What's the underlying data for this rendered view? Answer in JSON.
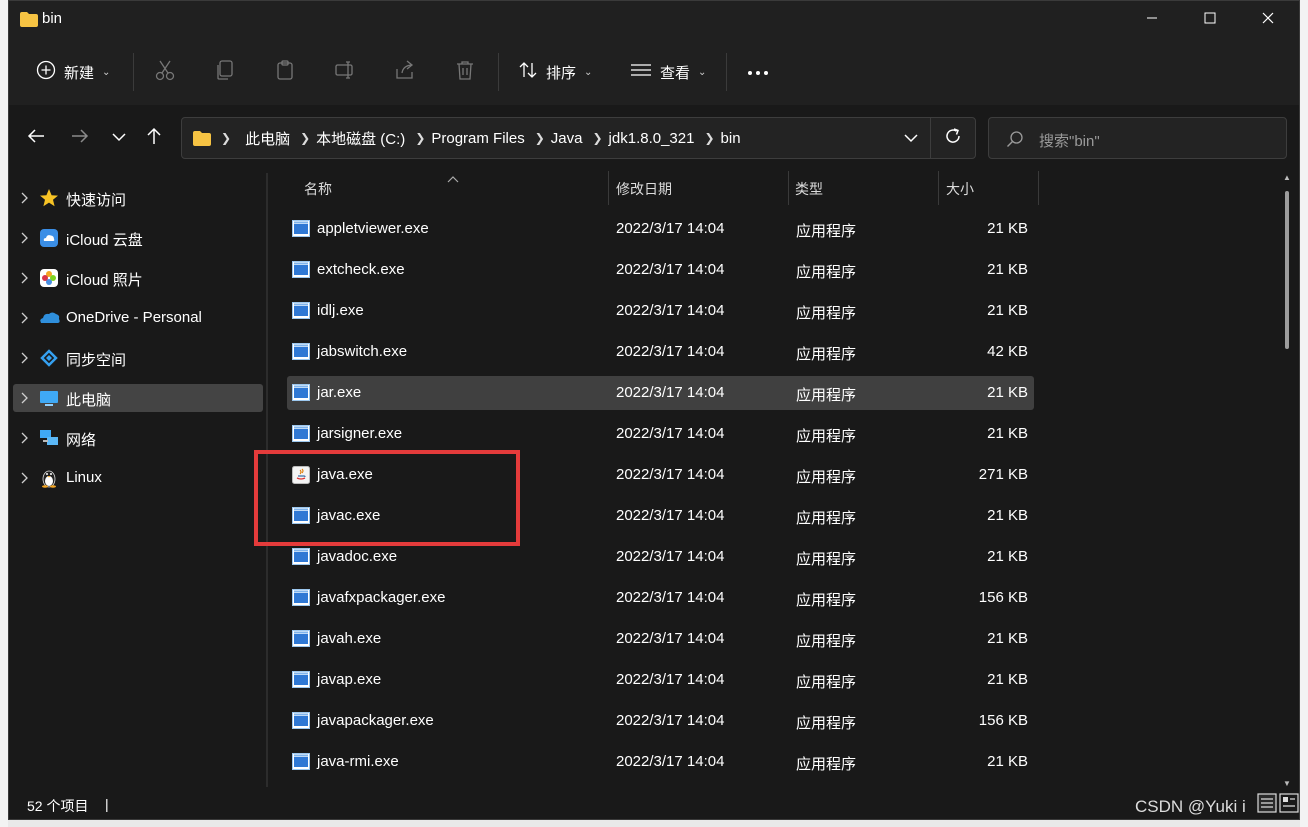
{
  "window": {
    "title": "bin",
    "controls": {
      "minimize": "minimize-icon",
      "maximize": "maximize-icon",
      "close": "close-icon"
    }
  },
  "toolbar": {
    "new_label": "新建",
    "sort_label": "排序",
    "view_label": "查看",
    "icons": [
      "cut-icon",
      "copy-icon",
      "paste-icon",
      "rename-icon",
      "share-icon",
      "delete-icon",
      "more-icon"
    ]
  },
  "address": {
    "breadcrumbs": [
      "此电脑",
      "本地磁盘 (C:)",
      "Program Files",
      "Java",
      "jdk1.8.0_321",
      "bin"
    ]
  },
  "search": {
    "placeholder": "搜索\"bin\""
  },
  "sidebar": {
    "items": [
      {
        "label": "快速访问",
        "icon": "star-icon"
      },
      {
        "label": "iCloud 云盘",
        "icon": "icloud-drive-icon"
      },
      {
        "label": "iCloud 照片",
        "icon": "icloud-photos-icon"
      },
      {
        "label": "OneDrive - Personal",
        "icon": "onedrive-icon"
      },
      {
        "label": "同步空间",
        "icon": "sync-space-icon"
      },
      {
        "label": "此电脑",
        "icon": "this-pc-icon",
        "selected": true
      },
      {
        "label": "网络",
        "icon": "network-icon"
      },
      {
        "label": "Linux",
        "icon": "linux-icon"
      }
    ]
  },
  "columns": {
    "name": "名称",
    "date": "修改日期",
    "type": "类型",
    "size": "大小"
  },
  "files": [
    {
      "name": "appletviewer.exe",
      "date": "2022/3/17 14:04",
      "type": "应用程序",
      "size": "21 KB"
    },
    {
      "name": "extcheck.exe",
      "date": "2022/3/17 14:04",
      "type": "应用程序",
      "size": "21 KB"
    },
    {
      "name": "idlj.exe",
      "date": "2022/3/17 14:04",
      "type": "应用程序",
      "size": "21 KB"
    },
    {
      "name": "jabswitch.exe",
      "date": "2022/3/17 14:04",
      "type": "应用程序",
      "size": "42 KB"
    },
    {
      "name": "jar.exe",
      "date": "2022/3/17 14:04",
      "type": "应用程序",
      "size": "21 KB",
      "selected": true
    },
    {
      "name": "jarsigner.exe",
      "date": "2022/3/17 14:04",
      "type": "应用程序",
      "size": "21 KB"
    },
    {
      "name": "java.exe",
      "date": "2022/3/17 14:04",
      "type": "应用程序",
      "size": "271 KB",
      "icon": "java-icon"
    },
    {
      "name": "javac.exe",
      "date": "2022/3/17 14:04",
      "type": "应用程序",
      "size": "21 KB"
    },
    {
      "name": "javadoc.exe",
      "date": "2022/3/17 14:04",
      "type": "应用程序",
      "size": "21 KB"
    },
    {
      "name": "javafxpackager.exe",
      "date": "2022/3/17 14:04",
      "type": "应用程序",
      "size": "156 KB"
    },
    {
      "name": "javah.exe",
      "date": "2022/3/17 14:04",
      "type": "应用程序",
      "size": "21 KB"
    },
    {
      "name": "javap.exe",
      "date": "2022/3/17 14:04",
      "type": "应用程序",
      "size": "21 KB"
    },
    {
      "name": "javapackager.exe",
      "date": "2022/3/17 14:04",
      "type": "应用程序",
      "size": "156 KB"
    },
    {
      "name": "java-rmi.exe",
      "date": "2022/3/17 14:04",
      "type": "应用程序",
      "size": "21 KB"
    }
  ],
  "status": {
    "item_count": "52 个项目",
    "separator": "|"
  },
  "watermark": "CSDN @Yuki i",
  "colors": {
    "background": "#191919",
    "selection": "#404040",
    "highlight_box": "#e43b3b",
    "folder": "#f6c343"
  }
}
